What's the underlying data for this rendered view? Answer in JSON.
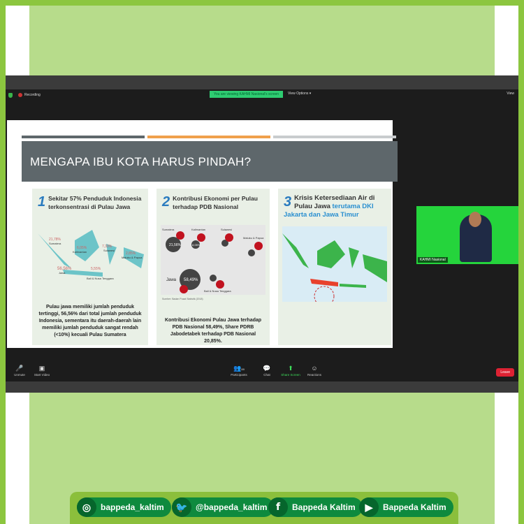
{
  "zoom": {
    "recording": "Recording",
    "viewing_banner": "You are viewing KAHMI Nasional's screen",
    "view_options": "View Options ▾",
    "view": "View",
    "participant_name": "KAHMI Nasional",
    "participants_count": "89",
    "toolbar": {
      "unmute": "Unmute",
      "start_video": "Start Video",
      "participants": "Participants",
      "chat": "Chat",
      "share_screen": "Share Screen",
      "reactions": "Reactions",
      "leave": "Leave"
    }
  },
  "slide": {
    "title": "MENGAPA IBU KOTA HARUS PINDAH?",
    "cards": [
      {
        "num": "1",
        "heading": "Sekitar 57% Penduduk Indonesia terkonsentrasi di Pulau Jawa",
        "labels": [
          "21,78%",
          "Sumatera",
          "6,05%",
          "Kalimantan",
          "7,33%",
          "Sulawesi",
          "2,85%",
          "Maluku & Papua",
          "56,56%",
          "Jawa",
          "5,55%",
          "Bali & Nusa Tenggara"
        ],
        "desc": "Pulau jawa memiliki jumlah penduduk tertinggi, 56,56% dari total jumlah penduduk Indonesia, sementara itu daerah-daerah lain memiliki jumlah penduduk sangat rendah (<10%) kecuali Pulau Sumatera"
      },
      {
        "num": "2",
        "heading": "Kontribusi Ekonomi per Pulau terhadap PDB Nasional",
        "labels": [
          "Sumatera",
          "21,56%",
          "Kalimantan",
          "8,05%",
          "Sulawesi",
          "Maluku & Papua",
          "Jawa",
          "58,49%",
          "Bali & Nusa Tenggara"
        ],
        "source": "Sumber: Badan Pusat Statistik (2018)",
        "desc": "Kontribusi Ekonomi Pulau Jawa terhadap PDB Nasional 58,49%, Share PDRB Jabodetabek terhadap PDB Nasional 20,85%."
      },
      {
        "num": "3",
        "heading": "Krisis Ketersediaan Air di Pulau Jawa",
        "heading_accent": "terutama DKI Jakarta dan Jawa Timur"
      }
    ]
  },
  "footer": [
    {
      "icon": "instagram",
      "label": "bappeda_kaltim"
    },
    {
      "icon": "twitter",
      "label": "@bappeda_kaltim"
    },
    {
      "icon": "facebook",
      "label": "Bappeda Kaltim"
    },
    {
      "icon": "youtube",
      "label": "Bappeda Kaltim"
    }
  ],
  "colors": {
    "frame": "#8cc63f",
    "panel": "#b7dc8b",
    "pill": "#0e8a3e"
  }
}
